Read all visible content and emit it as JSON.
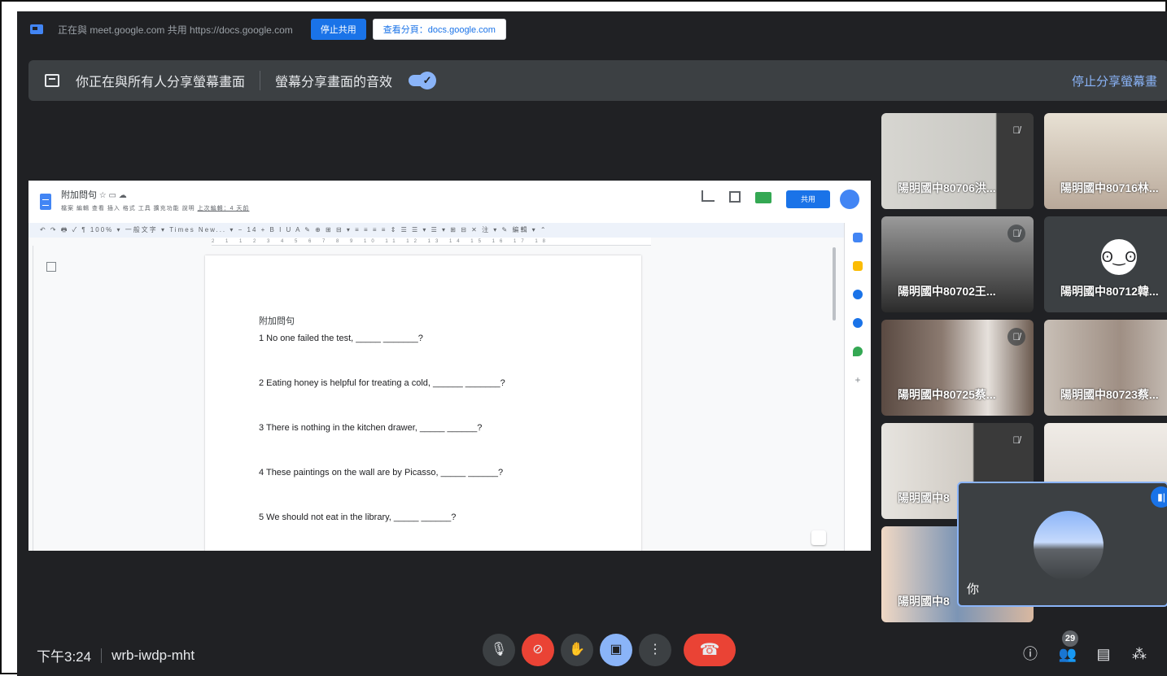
{
  "share_bar": {
    "message": "正在與 meet.google.com 共用 https://docs.google.com",
    "stop_label": "停止共用",
    "view_label": "查看分頁：docs.google.com"
  },
  "banner": {
    "presenting_text": "你正在與所有人分享螢幕畫面",
    "audio_text": "螢幕分享畫面的音效",
    "audio_enabled": true,
    "stop_presenting": "停止分享螢幕畫"
  },
  "doc": {
    "title": "附加問句",
    "menu": "檔案  編輯  查看  插入  格式  工具  擴充功能  說明",
    "last_edit": "上次編輯：4 天前",
    "share_label": "共用",
    "toolbar_text": "↶ ↷ 🖶 ✓ ¶  100% ▾  一般文字 ▾  Times New... ▾  −  14  +  B  I  U  A  ✎  ⊕  ⊞  ⊟ ▾  ≡ ≡ ≡ ≡  ⇕  ☰ ☰ ▾  ☰ ▾  ⊞  ⊟  ✕  注 ▾      ✎ 編輯 ▾  ⌃",
    "ruler_text": "2 1 1 2 3 4 5 6 7 8 9 10 11 12 13 14 15 16 17 18",
    "page_heading": "附加問句",
    "lines": [
      "1 No one failed the test, _____ _______?",
      "2 Eating honey is helpful for treating a cold, ______ _______?",
      "3 There is nothing in the kitchen drawer, _____ ______?",
      "4 These paintings on the wall are by Picasso, _____ ______?",
      "5 We should not eat in the library, _____ ______?"
    ]
  },
  "participants": [
    {
      "name": "陽明國中80706洪...",
      "muted": true
    },
    {
      "name": "陽明國中80716林...",
      "muted": true
    },
    {
      "name": "陽明國中80702王...",
      "muted": true
    },
    {
      "name": "陽明國中80712韓...",
      "muted": false
    },
    {
      "name": "陽明國中80725蔡...",
      "muted": true
    },
    {
      "name": "陽明國中80723蔡...",
      "muted": false
    },
    {
      "name": "陽明國中8",
      "muted": true
    },
    {
      "name": "陽明國中8",
      "muted": false
    }
  ],
  "self_view": {
    "name": "你"
  },
  "footer": {
    "time": "下午3:24",
    "meeting_code": "wrb-iwdp-mht",
    "participant_count": "29"
  },
  "colors": {
    "background": "#202124",
    "tile": "#3c4043",
    "accent_blue": "#8ab4f8",
    "end_call_red": "#ea4335"
  }
}
